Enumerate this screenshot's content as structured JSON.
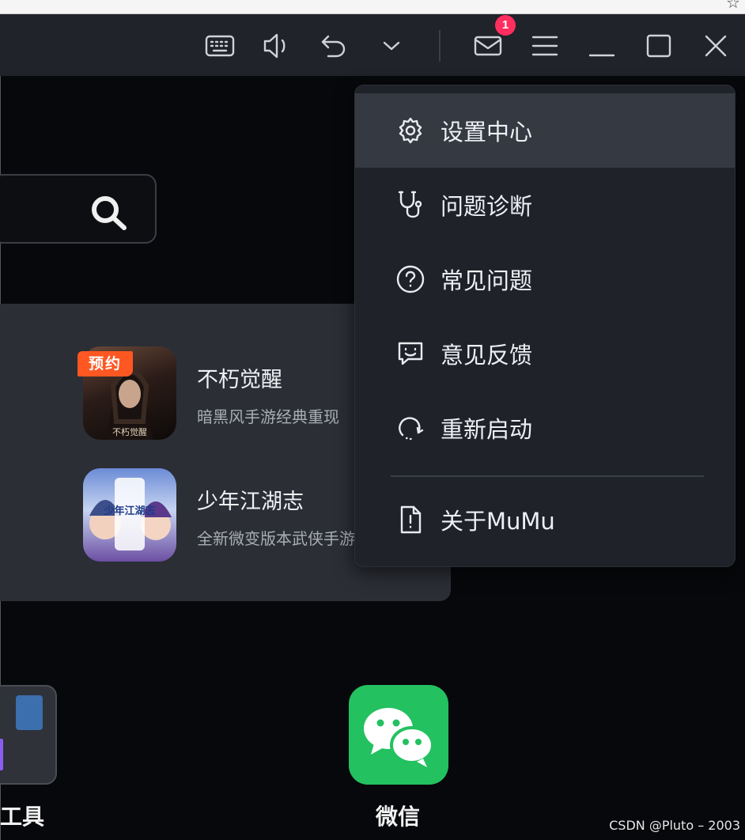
{
  "titlebar": {
    "buttons": [
      {
        "id": "keyboard",
        "icon": "keyboard-icon"
      },
      {
        "id": "volume",
        "icon": "volume-icon"
      },
      {
        "id": "back",
        "icon": "undo-icon"
      },
      {
        "id": "more",
        "icon": "chevron-down-icon"
      },
      {
        "id": "messages",
        "icon": "mail-icon"
      },
      {
        "id": "menu",
        "icon": "hamburger-menu-icon"
      },
      {
        "id": "minimize",
        "icon": "minimize-icon"
      },
      {
        "id": "maximize",
        "icon": "maximize-icon"
      },
      {
        "id": "close",
        "icon": "close-icon"
      }
    ],
    "mail_badge_count": "1"
  },
  "menu": {
    "items": [
      {
        "label": "设置中心",
        "icon": "gear-icon"
      },
      {
        "label": "问题诊断",
        "icon": "stethoscope-icon"
      },
      {
        "label": "常见问题",
        "icon": "help-circle-icon"
      },
      {
        "label": "意见反馈",
        "icon": "feedback-smile-icon"
      },
      {
        "label": "重新启动",
        "icon": "restart-icon"
      },
      {
        "label": "关于MuMu",
        "icon": "info-document-icon"
      }
    ]
  },
  "recommendations": [
    {
      "title": "不朽觉醒",
      "desc": "暗黑风手游经典重现",
      "tag": "预约",
      "poster_text": "不朽觉醒"
    },
    {
      "title": "少年江湖志",
      "desc": "全新微变版本武侠手游",
      "poster_text": "少年江湖志"
    }
  ],
  "home": {
    "tools_label": "工具",
    "wechat_label": "微信"
  },
  "watermark": "CSDN @Pluto – 2003",
  "colors": {
    "titlebar_bg": "#20232a",
    "menu_bg": "#1f2229",
    "menu_active_bg": "#353942",
    "badge": "#ff2e5f",
    "wechat_green": "#23c160",
    "reserve_tag": "#ff5722"
  }
}
